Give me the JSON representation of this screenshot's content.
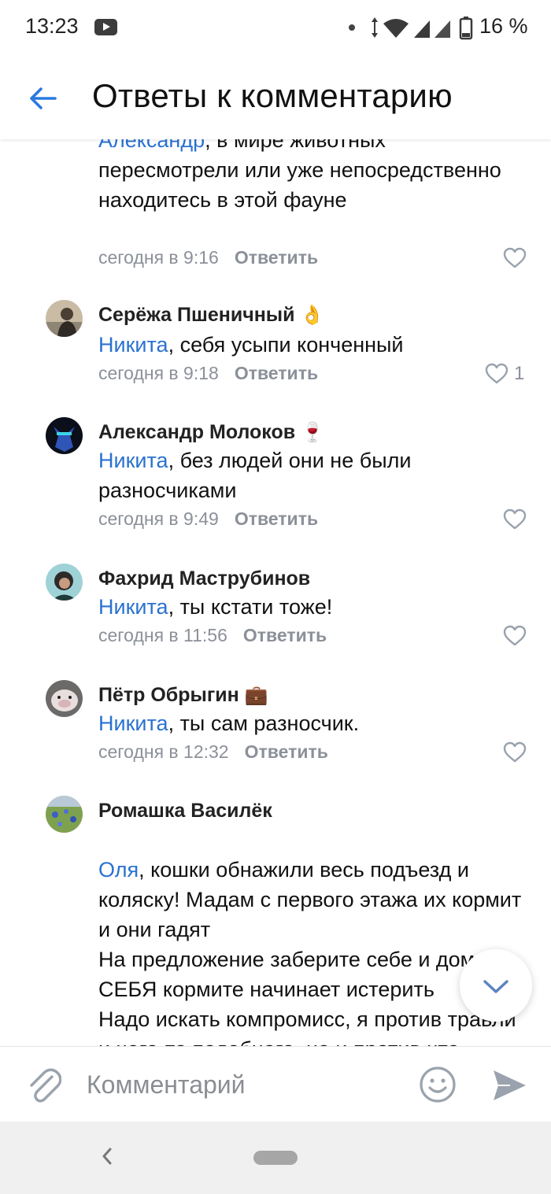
{
  "status_bar": {
    "time": "13:23",
    "battery_text": "16 %"
  },
  "header": {
    "title": "Ответы к комментарию"
  },
  "colors": {
    "accent": "#2a72d0",
    "meta": "#8b9099",
    "text": "#111111"
  },
  "comments": [
    {
      "mention": "Александр",
      "text": ", в мире животных пересмотрели или уже непосредственно находитесь в этой фауне",
      "time": "сегодня в 9:16",
      "reply": "Ответить"
    },
    {
      "author": "Серёжа Пшеничный",
      "emoji": "👌",
      "mention": "Никита",
      "text": ", себя усыпи конченный",
      "time": "сегодня в 9:18",
      "reply": "Ответить",
      "likes": "1"
    },
    {
      "author": "Александр Молоков",
      "emoji": "🍷",
      "mention": "Никита",
      "text": ", без людей они не были разносчиками",
      "time": "сегодня в 9:49",
      "reply": "Ответить"
    },
    {
      "author": "Фахрид Маструбинов",
      "mention": "Никита",
      "text": ", ты кстати тоже!",
      "time": "сегодня в 11:56",
      "reply": "Ответить"
    },
    {
      "author": "Пётр Обрыгин",
      "emoji": "💼",
      "mention": "Никита",
      "text": ", ты сам разносчик.",
      "time": "сегодня в 12:32",
      "reply": "Ответить"
    },
    {
      "author": "Ромашка Василёк",
      "mention": "Оля",
      "text": ", кошки обнажили весь подъезд и коляску! Мадам с первого этажа их кормит и они гадят\nНа предложение заберите себе и дома У СЕБЯ кормите начинает истерить\nНадо искать компромисс, я против травли и чего-то подобного, но и против что животных прикармливают"
    }
  ],
  "composer": {
    "placeholder": "Комментарий"
  },
  "icons": {
    "back": "back-arrow-icon",
    "like": "heart-icon",
    "attach": "paperclip-icon",
    "emoji": "smile-icon",
    "send": "send-icon",
    "scroll": "chevron-down-icon"
  }
}
